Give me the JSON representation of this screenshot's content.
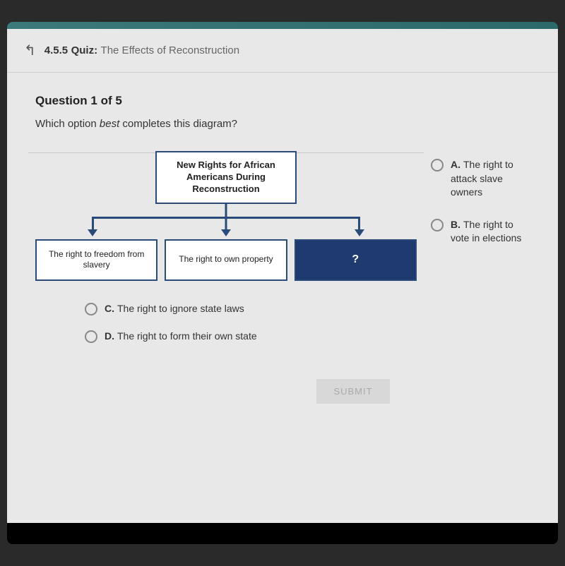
{
  "header": {
    "section_number": "4.5.5",
    "label": "Quiz:",
    "title": "The Effects of Reconstruction"
  },
  "question": {
    "number_label": "Question 1 of 5",
    "prompt_prefix": "Which option ",
    "prompt_emphasis": "best",
    "prompt_suffix": " completes this diagram?"
  },
  "diagram": {
    "root": "New Rights for African Americans During Reconstruction",
    "children": [
      "The right to freedom from slavery",
      "The right to own property",
      "?"
    ]
  },
  "options": [
    {
      "letter": "A.",
      "text": "The right to attack slave owners"
    },
    {
      "letter": "B.",
      "text": "The right to vote in elections"
    },
    {
      "letter": "C.",
      "text": "The right to ignore state laws"
    },
    {
      "letter": "D.",
      "text": "The right to form their own state"
    }
  ],
  "submit_label": "SUBMIT"
}
